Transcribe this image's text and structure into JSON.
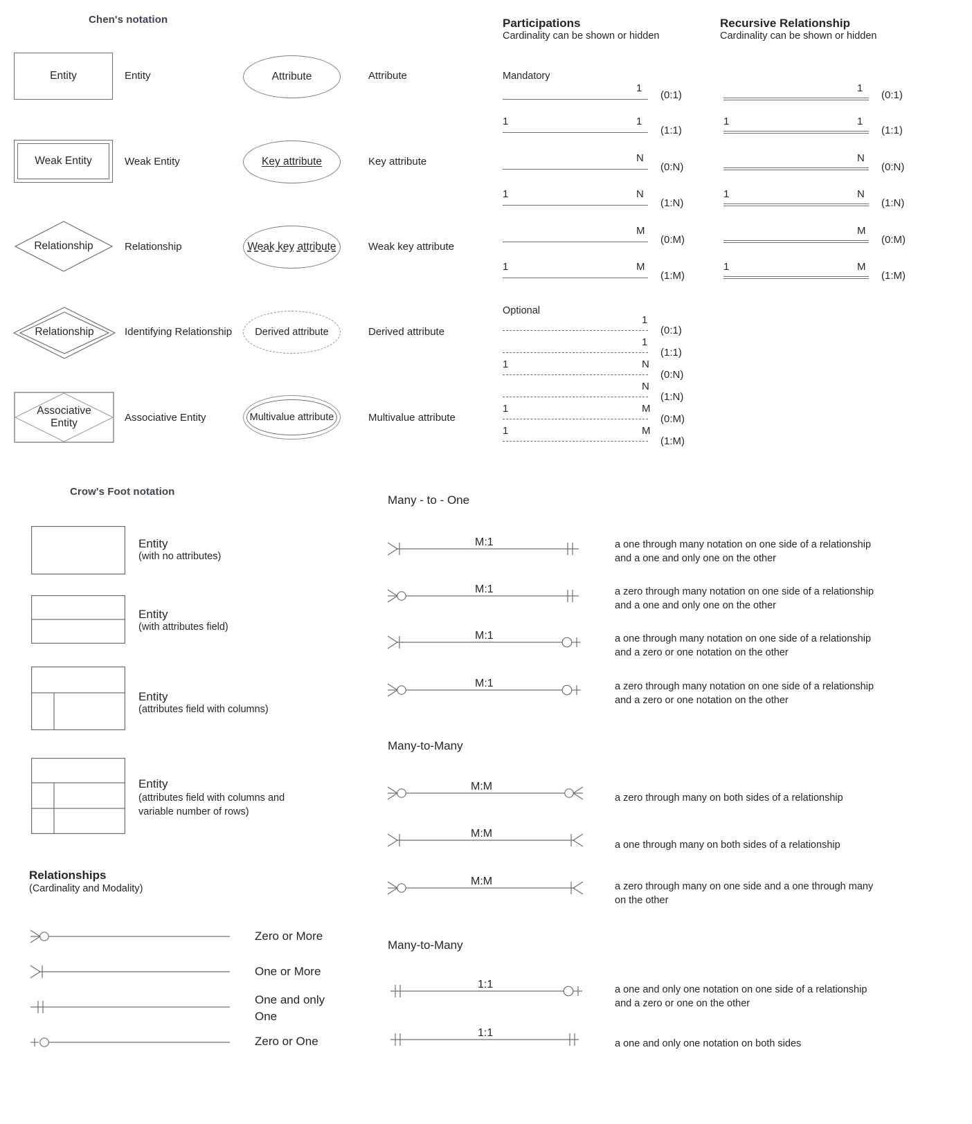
{
  "sections": {
    "chen_title": "Chen's notation",
    "participations_title": "Participations",
    "participations_sub": "Cardinality can be shown or hidden",
    "recursive_title": "Recursive Relationship",
    "recursive_sub": "Cardinality can be shown or hidden",
    "mandatory_label": "Mandatory",
    "optional_label": "Optional",
    "crowsfoot_title": "Crow's Foot notation",
    "relationships_title": "Relationships",
    "relationships_sub": "(Cardinality and Modality)",
    "many_to_one_title": "Many - to - One",
    "many_to_many_title": "Many-to-Many",
    "many_to_many_title2": "Many-to-Many"
  },
  "chen_left": [
    {
      "shape": "rectangle",
      "shape_text": "Entity",
      "label": "Entity"
    },
    {
      "shape": "double-rectangle",
      "shape_text": "Weak Entity",
      "label": "Weak Entity"
    },
    {
      "shape": "diamond",
      "shape_text": "Relationship",
      "label": "Relationship"
    },
    {
      "shape": "double-diamond",
      "shape_text": "Relationship",
      "label": "Identifying Relationship"
    },
    {
      "shape": "diamond-in-rect",
      "shape_text": "Associative\nEntity",
      "label": "Associative Entity"
    }
  ],
  "chen_right": [
    {
      "shape": "ellipse",
      "shape_text": "Attribute",
      "label": "Attribute"
    },
    {
      "shape": "ellipse-underline",
      "shape_text": "Key attribute",
      "label": "Key attribute"
    },
    {
      "shape": "ellipse-dash-underline",
      "shape_text": "Weak key attribute",
      "label": "Weak key attribute"
    },
    {
      "shape": "ellipse-dashed",
      "shape_text": "Derived attribute",
      "label": "Derived attribute"
    },
    {
      "shape": "ellipse-double",
      "shape_text": "Multivalue attribute",
      "label": "Multivalue attribute"
    }
  ],
  "participations_mandatory": [
    {
      "left": "",
      "right": "1",
      "card": "(0:1)"
    },
    {
      "left": "1",
      "right": "1",
      "card": "(1:1)"
    },
    {
      "left": "",
      "right": "N",
      "card": "(0:N)"
    },
    {
      "left": "1",
      "right": "N",
      "card": "(1:N)"
    },
    {
      "left": "",
      "right": "M",
      "card": "(0:M)"
    },
    {
      "left": "1",
      "right": "M",
      "card": "(1:M)"
    }
  ],
  "participations_optional": [
    {
      "left": "",
      "right": "1",
      "card": "(0:1)"
    },
    {
      "left": "",
      "right": "1",
      "card": "(1:1)"
    },
    {
      "left": "1",
      "right": "N",
      "card": "(0:N)"
    },
    {
      "left": "",
      "right": "N",
      "card": "(1:N)"
    },
    {
      "left": "1",
      "right": "M",
      "card": "(0:M)"
    },
    {
      "left": "1",
      "right": "M",
      "card": "(1:M)"
    }
  ],
  "recursive": [
    {
      "left": "",
      "right": "1",
      "card": "(0:1)"
    },
    {
      "left": "1",
      "right": "1",
      "card": "(1:1)"
    },
    {
      "left": "",
      "right": "N",
      "card": "(0:N)"
    },
    {
      "left": "1",
      "right": "N",
      "card": "(1:N)"
    },
    {
      "left": "",
      "right": "M",
      "card": "(0:M)"
    },
    {
      "left": "1",
      "right": "M",
      "card": "(1:M)"
    }
  ],
  "crowsfoot_entities": [
    {
      "title": "Entity",
      "note": "(with no attributes)"
    },
    {
      "title": "Entity",
      "note": "(with attributes field)"
    },
    {
      "title": "Entity",
      "note": "(attributes field with columns)"
    },
    {
      "title": "Entity",
      "note": "(attributes field with columns and\nvariable number of rows)"
    }
  ],
  "relationship_symbols": [
    {
      "symbol": "zero-or-more",
      "label": "Zero or More"
    },
    {
      "symbol": "one-or-more",
      "label": "One or More"
    },
    {
      "symbol": "one-only-one",
      "label": "One and only\nOne"
    },
    {
      "symbol": "zero-or-one",
      "label": "Zero or One"
    }
  ],
  "many_to_one_rows": [
    {
      "left": "one-or-more",
      "mid": "M:1",
      "right": "one-only-one",
      "desc": "a one through many notation on one side of a relationship\nand a one and only one on the other"
    },
    {
      "left": "zero-or-more",
      "mid": "M:1",
      "right": "one-only-one",
      "desc": "a zero through many notation on one side of a relationship\nand a one and only one on the other"
    },
    {
      "left": "one-or-more",
      "mid": "M:1",
      "right": "zero-or-one",
      "desc": "a one through many notation on one side of a relationship\nand a zero or one notation on the other"
    },
    {
      "left": "zero-or-more",
      "mid": "M:1",
      "right": "zero-or-one",
      "desc": "a zero through many notation on one side of a relationship\nand a zero or one notation on the other"
    }
  ],
  "many_to_many_rows": [
    {
      "left": "zero-or-more",
      "mid": "M:M",
      "right": "zero-or-more",
      "desc": "a zero through many on both sides of a relationship"
    },
    {
      "left": "one-or-more",
      "mid": "M:M",
      "right": "one-or-more",
      "desc": "a one through many on both sides of a relationship"
    },
    {
      "left": "zero-or-more",
      "mid": "M:M",
      "right": "one-or-more",
      "desc": "a zero through many on one side and a one through many\non the other"
    }
  ],
  "one_to_one_rows": [
    {
      "left": "one-only-one",
      "mid": "1:1",
      "right": "zero-or-one",
      "desc": "a one and only one notation on one side of a relationship\nand a zero or one on the other"
    },
    {
      "left": "one-only-one",
      "mid": "1:1",
      "right": "one-only-one",
      "desc": "a one and only one notation on both sides"
    }
  ],
  "colors": {
    "line": "#6c7076",
    "text": "#23272c",
    "heading": "#3d4450"
  }
}
